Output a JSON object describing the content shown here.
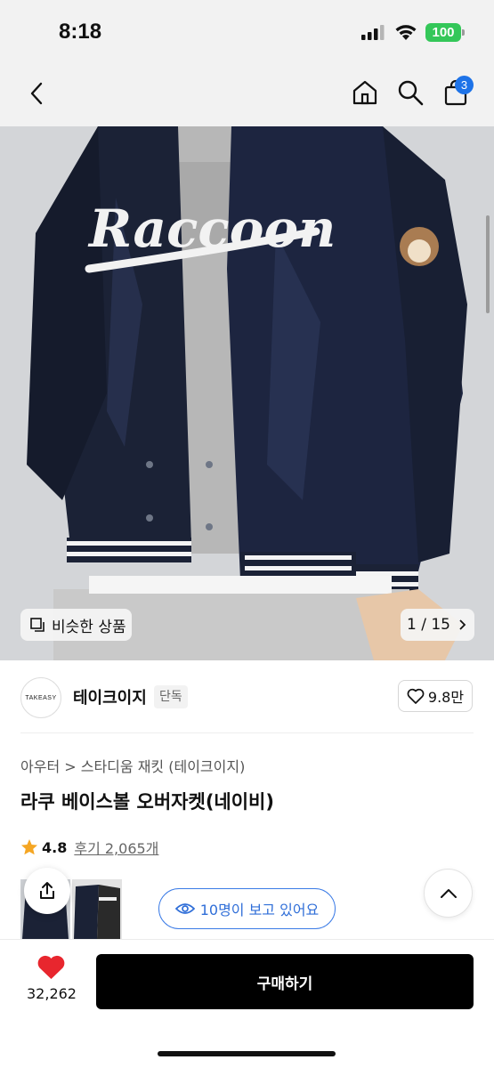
{
  "status": {
    "time": "8:18",
    "battery": "100"
  },
  "nav": {
    "cart_count": "3"
  },
  "gallery": {
    "similar_label": "비슷한 상품",
    "counter": "1 / 15",
    "jacket_text": "Raccoon",
    "colors": {
      "jacket": "#1b2236",
      "hoodie": "#b9b9b9",
      "background": "#cfd2d6"
    }
  },
  "brand": {
    "logo_text": "TAKEASY",
    "name": "테이크이지",
    "tag": "단독",
    "likes": "9.8만"
  },
  "product": {
    "breadcrumb": "아우터 > 스타디움 재킷 (테이크이지)",
    "title": "라쿠 베이스볼 오버자켓(네이비)",
    "rating": "4.8",
    "reviews": "후기 2,065개"
  },
  "viewers": "10명이 보고 있어요",
  "bottom": {
    "likes": "32,262",
    "buy_label": "구매하기"
  },
  "colors": {
    "accent_blue": "#1e73e8",
    "heart_red": "#e8262e",
    "star": "#f5a623"
  }
}
